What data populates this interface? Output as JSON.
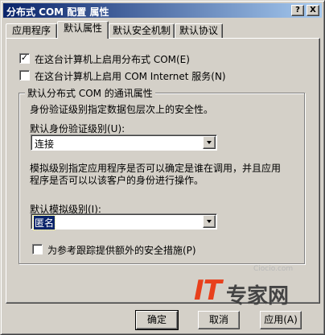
{
  "window": {
    "title": "分布式 COM 配置 属性",
    "help_button": "?",
    "close_button": "X"
  },
  "tabs": [
    {
      "label": "应用程序",
      "active": false
    },
    {
      "label": "默认属性",
      "active": true
    },
    {
      "label": "默认安全机制",
      "active": false
    },
    {
      "label": "默认协议",
      "active": false
    }
  ],
  "options": {
    "enable_dcom": {
      "label": "在这台计算机上启用分布式 COM(E)",
      "checked": true,
      "mark": "✓"
    },
    "enable_internet": {
      "label": "在这台计算机上启用 COM Internet 服务(N)",
      "checked": false,
      "mark": ""
    }
  },
  "comm_group": {
    "title": "默认分布式 COM 的通讯属性",
    "auth_desc": "身份验证级别指定数据包层次上的安全性。",
    "auth_label": "默认身份验证级别(U):",
    "auth_value": "连接",
    "imp_desc_1": "模拟级别指定应用程序是否可以确定是谁在调用，并且应用",
    "imp_desc_2": "程序是否可以以该客户的身份进行操作。",
    "imp_label": "默认模拟级别(I):",
    "imp_value": "匿名",
    "tracking": {
      "label": "为参考跟踪提供额外的安全措施(P)",
      "checked": false,
      "mark": ""
    }
  },
  "buttons": {
    "ok": "确定",
    "cancel": "取消",
    "apply": "应用(A)"
  },
  "watermark": {
    "logo_it": "IT",
    "logo_text": "专家网",
    "site": "Ciocio.com"
  }
}
